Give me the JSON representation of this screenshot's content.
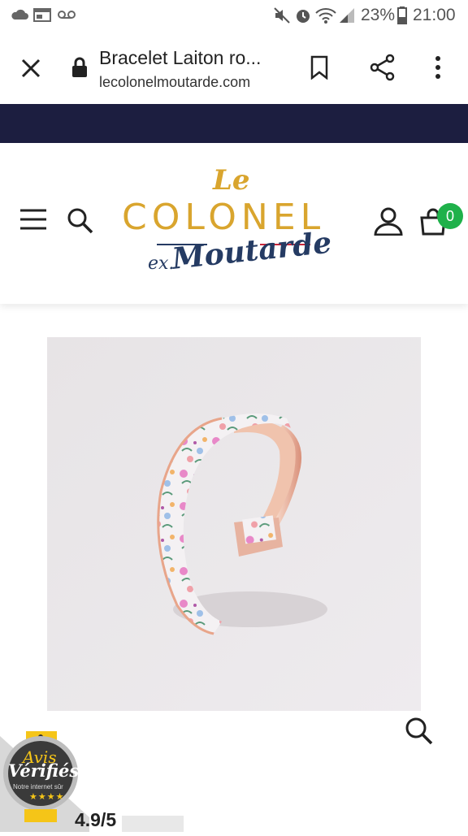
{
  "status_bar": {
    "battery": "23%",
    "time": "21:00",
    "icons": [
      "cloud-icon",
      "browser-icon",
      "voicemail-icon",
      "mute-icon",
      "alarm-icon",
      "wifi-icon",
      "signal-icon",
      "battery-icon"
    ]
  },
  "tab": {
    "title": "Bracelet Laiton ro...",
    "url": "lecolonelmoutarde.com",
    "icons": [
      "close-icon",
      "lock-icon",
      "bookmark-icon",
      "share-icon",
      "more-icon"
    ]
  },
  "header": {
    "logo_le": "Le",
    "logo_colonel": "COLONEL",
    "logo_ex": "ex.",
    "logo_moutarde": "Moutarde",
    "cart_count": "0",
    "icons": [
      "menu-icon",
      "search-icon",
      "account-icon",
      "cart-icon"
    ]
  },
  "badge": {
    "title1": "Avis",
    "title2": "Vérifiés",
    "subtitle": "Notre internet sûr",
    "rating": "4.9/5"
  },
  "colors": {
    "navy": "#1c1e40",
    "gold": "#d9a52e",
    "logo_blue": "#253b63",
    "cart_badge": "#1fb14a"
  }
}
